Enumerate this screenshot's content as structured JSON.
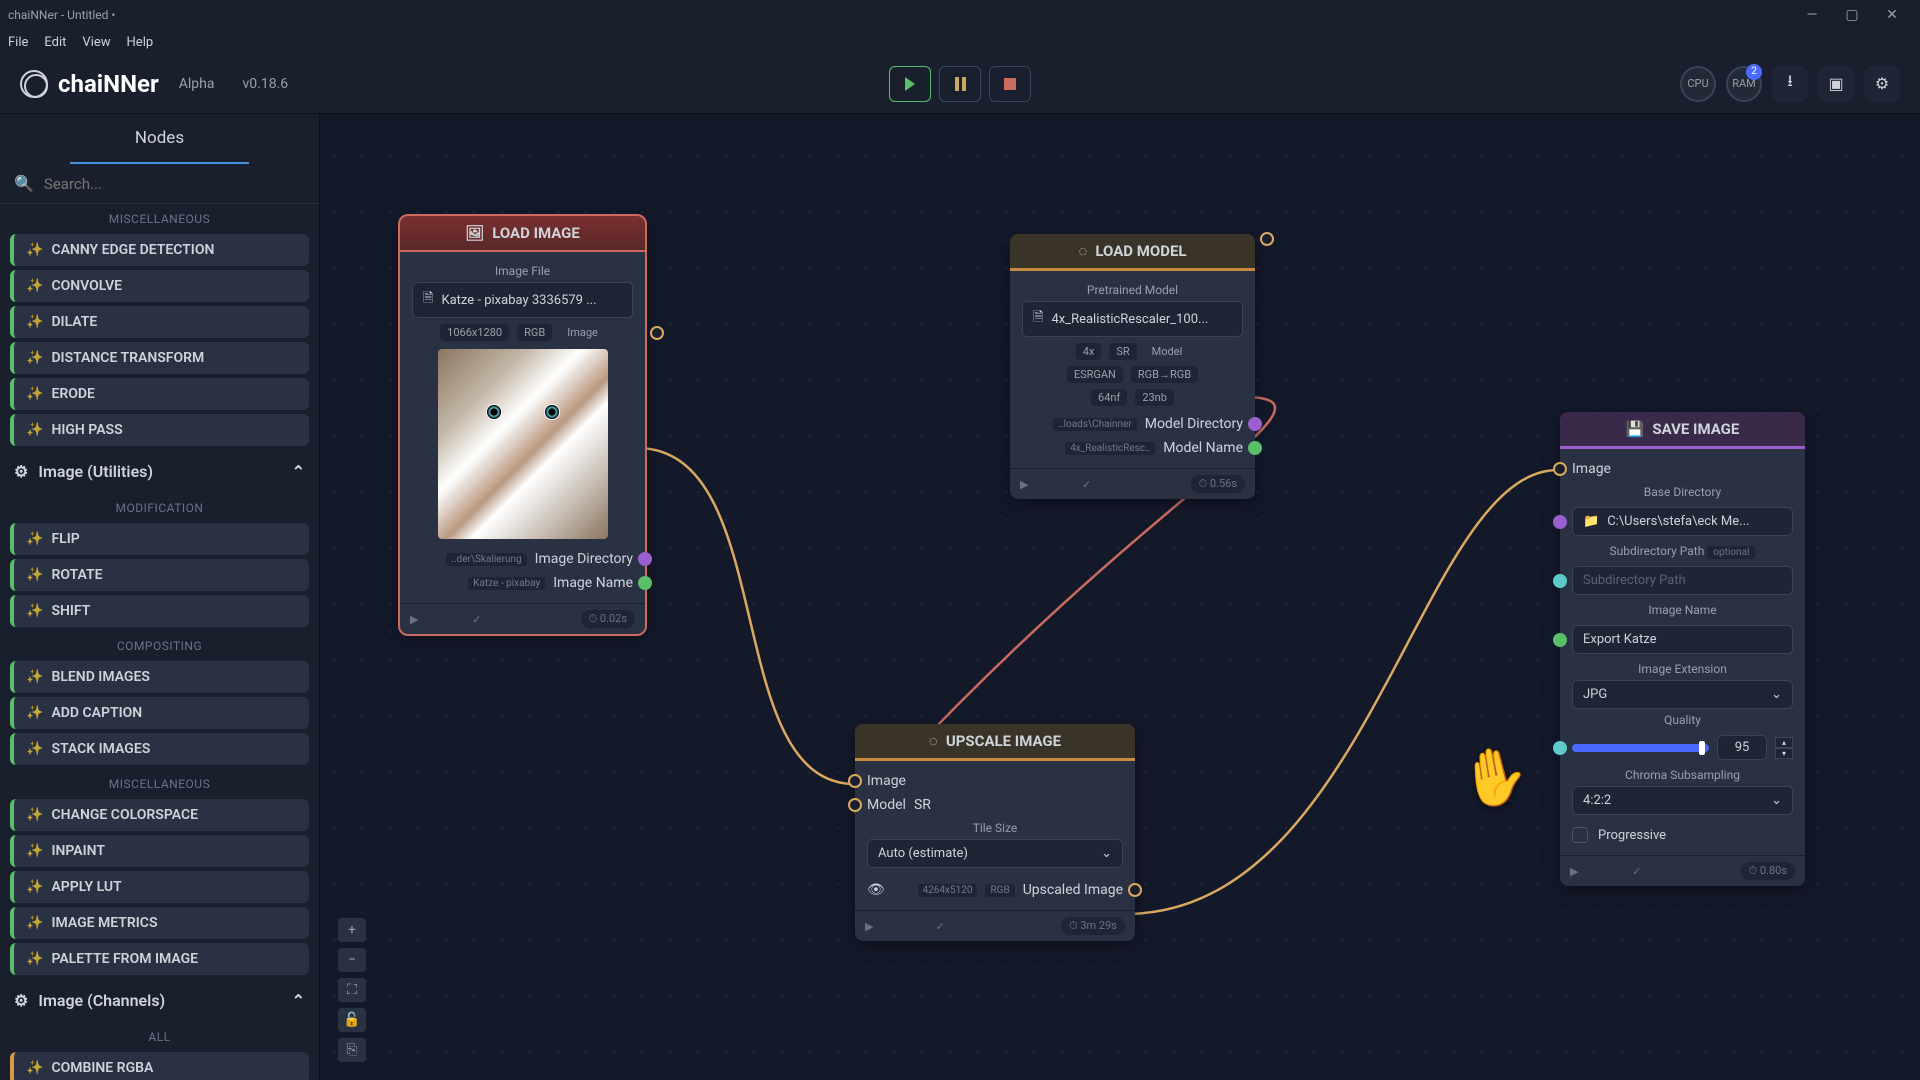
{
  "window": {
    "title": "chaiNNer - Untitled •"
  },
  "menubar": [
    "File",
    "Edit",
    "View",
    "Help"
  ],
  "app": {
    "name": "chaiNNer",
    "stage": "Alpha",
    "version": "v0.18.6"
  },
  "top_chips": {
    "cpu": "CPU",
    "ram": "RAM",
    "ram_badge": "2"
  },
  "sidebar": {
    "tab": "Nodes",
    "search_placeholder": "Search...",
    "groups": {
      "misc1": "MISCELLANEOUS",
      "misc1_items": [
        "CANNY EDGE DETECTION",
        "CONVOLVE",
        "DILATE",
        "DISTANCE TRANSFORM",
        "ERODE",
        "HIGH PASS"
      ],
      "cat_util": "Image (Utilities)",
      "mod": "MODIFICATION",
      "mod_items": [
        "FLIP",
        "ROTATE",
        "SHIFT"
      ],
      "comp": "COMPOSITING",
      "comp_items": [
        "BLEND IMAGES",
        "ADD CAPTION",
        "STACK IMAGES"
      ],
      "misc2": "MISCELLANEOUS",
      "misc2_items": [
        "CHANGE COLORSPACE",
        "INPAINT",
        "APPLY LUT",
        "IMAGE METRICS",
        "PALETTE FROM IMAGE"
      ],
      "cat_chan": "Image (Channels)",
      "all": "ALL",
      "all_items": [
        "COMBINE RGBA"
      ]
    }
  },
  "nodes": {
    "load_image": {
      "title": "LOAD IMAGE",
      "file_label": "Image File",
      "file_value": "Katze - pixabay 3336579 ...",
      "dims": "1066x1280",
      "mode": "RGB",
      "out_img": "Image",
      "dir_sub": "..der\\Skalierung",
      "dir_label": "Image Directory",
      "name_sub": "Katze - pixabay",
      "name_label": "Image Name",
      "time": "⏱ 0.02s"
    },
    "load_model": {
      "title": "LOAD MODEL",
      "file_label": "Pretrained Model",
      "file_value": "4x_RealisticRescaler_100...",
      "scale": "4x",
      "type": "SR",
      "out_model": "Model",
      "arch": "ESRGAN",
      "color": "RGB→RGB",
      "nf": "64nf",
      "nb": "23nb",
      "dir_sub": "..loads\\Chainner",
      "dir_label": "Model Directory",
      "name_sub": "4x_RealisticResc..",
      "name_label": "Model Name",
      "time": "⏱ 0.56s"
    },
    "upscale": {
      "title": "UPSCALE IMAGE",
      "in_image": "Image",
      "in_model": "Model",
      "model_tag": "SR",
      "tile_label": "Tile Size",
      "tile_value": "Auto (estimate)",
      "out_dims": "4264x5120",
      "out_mode": "RGB",
      "out_label": "Upscaled Image",
      "time": "⏱ 3m 29s"
    },
    "save": {
      "title": "SAVE IMAGE",
      "in_image": "Image",
      "base_label": "Base Directory",
      "base_value": "C:\\Users\\stefa\\eck Me...",
      "sub_label": "Subdirectory Path",
      "sub_opt": "optional",
      "sub_placeholder": "Subdirectory Path",
      "name_label": "Image Name",
      "name_value": "Export Katze",
      "ext_label": "Image Extension",
      "ext_value": "JPG",
      "quality_label": "Quality",
      "quality_value": "95",
      "chroma_label": "Chroma Subsampling",
      "chroma_value": "4:2:2",
      "prog_label": "Progressive",
      "time": "⏱ 0.80s"
    }
  }
}
